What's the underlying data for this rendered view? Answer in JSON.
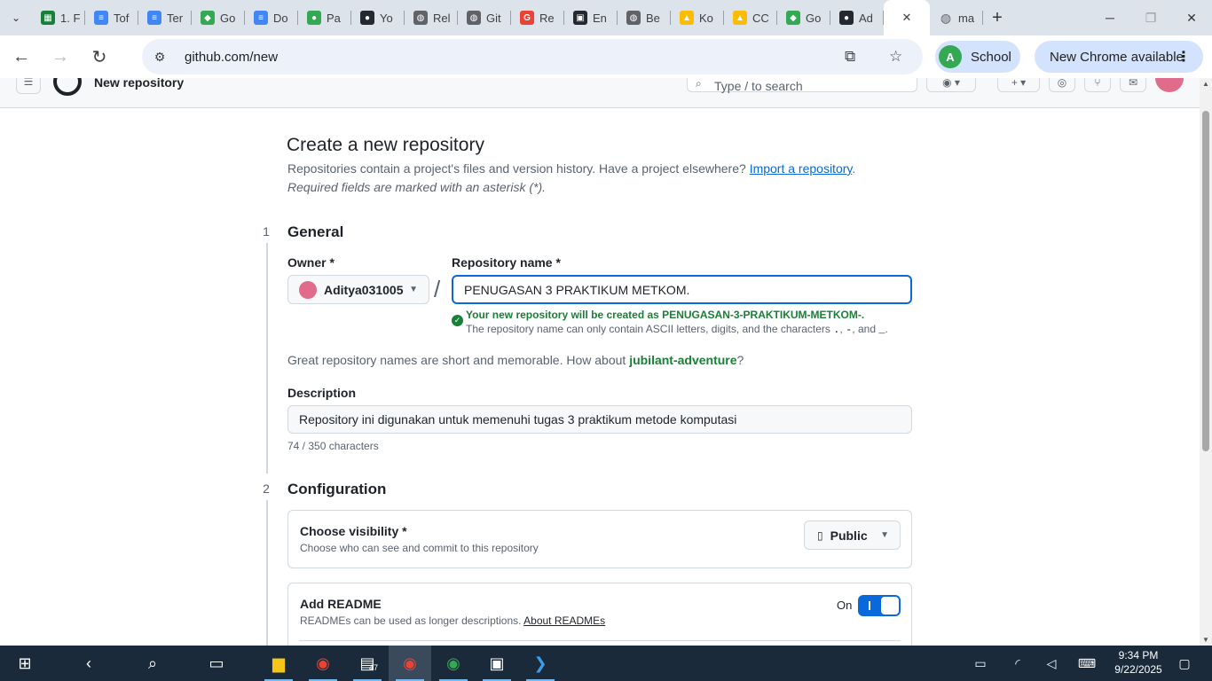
{
  "browser": {
    "tabs": [
      {
        "label": "1. F",
        "color": "#188038",
        "glyph": "▦"
      },
      {
        "label": "Tof",
        "color": "#4285f4",
        "glyph": "≡"
      },
      {
        "label": "Ter",
        "color": "#4285f4",
        "glyph": "≡"
      },
      {
        "label": "Go",
        "color": "#34a853",
        "glyph": "◆"
      },
      {
        "label": "Do",
        "color": "#4285f4",
        "glyph": "≡"
      },
      {
        "label": "Pa",
        "color": "#34a853",
        "glyph": "●"
      },
      {
        "label": "Yo",
        "color": "#24292f",
        "glyph": "●"
      },
      {
        "label": "Rel",
        "color": "#5f6368",
        "glyph": "◍"
      },
      {
        "label": "Git",
        "color": "#5f6368",
        "glyph": "◍"
      },
      {
        "label": "Re",
        "color": "#ea4335",
        "glyph": "G"
      },
      {
        "label": "En",
        "color": "#24292f",
        "glyph": "▣"
      },
      {
        "label": "Be",
        "color": "#5f6368",
        "glyph": "◍"
      },
      {
        "label": "Ko",
        "color": "#fbbc04",
        "glyph": "▲"
      },
      {
        "label": "CC",
        "color": "#fbbc04",
        "glyph": "▲"
      },
      {
        "label": "Go",
        "color": "#34a853",
        "glyph": "◆"
      },
      {
        "label": "Ad",
        "color": "#24292f",
        "glyph": "●"
      }
    ],
    "active_tab_close": "✕",
    "last_tab": {
      "label": "ma",
      "glyph": "◍"
    },
    "url": "github.com/new",
    "profile_initial": "A",
    "profile_label": "School",
    "update_label": "New Chrome available"
  },
  "gh_header": {
    "title": "New repository",
    "search_placeholder": "Type / to search"
  },
  "page": {
    "title": "Create a new repository",
    "intro_text": "Repositories contain a project's files and version history. Have a project elsewhere? ",
    "import_link": "Import a repository",
    "intro_end": ".",
    "required_note": "Required fields are marked with an asterisk (*).",
    "step1_number": "1",
    "step1_title": "General",
    "owner_label": "Owner *",
    "owner_value": "Aditya031005",
    "slash": "/",
    "repo_label": "Repository name *",
    "repo_value": "PENUGASAN 3 PRAKTIKUM METKOM.",
    "success_msg": "Your new repository will be created as PENUGASAN-3-PRAKTIKUM-METKOM-.",
    "hint_prefix": "The repository name can only contain ASCII letters, digits, and the characters ",
    "hint_chars1": ".",
    "hint_sep1": ", ",
    "hint_chars2": "-",
    "hint_sep2": ", and ",
    "hint_chars3": "_",
    "hint_end": ".",
    "suggestion_prefix": "Great repository names are short and memorable. How about ",
    "suggestion_name": "jubilant-adventure",
    "suggestion_end": "?",
    "description_label": "Description",
    "description_value": "Repository ini digunakan untuk memenuhi tugas 3 praktikum metode komputasi",
    "char_count": "74 / 350 characters",
    "step2_number": "2",
    "step2_title": "Configuration",
    "visibility_title": "Choose visibility *",
    "visibility_sub": "Choose who can see and commit to this repository",
    "visibility_value": "Public",
    "readme_title": "Add README",
    "readme_sub": "READMEs can be used as longer descriptions. ",
    "readme_link": "About READMEs",
    "readme_toggle_label": "On",
    "readme_on": true
  },
  "taskbar": {
    "time": "9:34 PM",
    "date": "9/22/2025",
    "badge_count": "47"
  }
}
